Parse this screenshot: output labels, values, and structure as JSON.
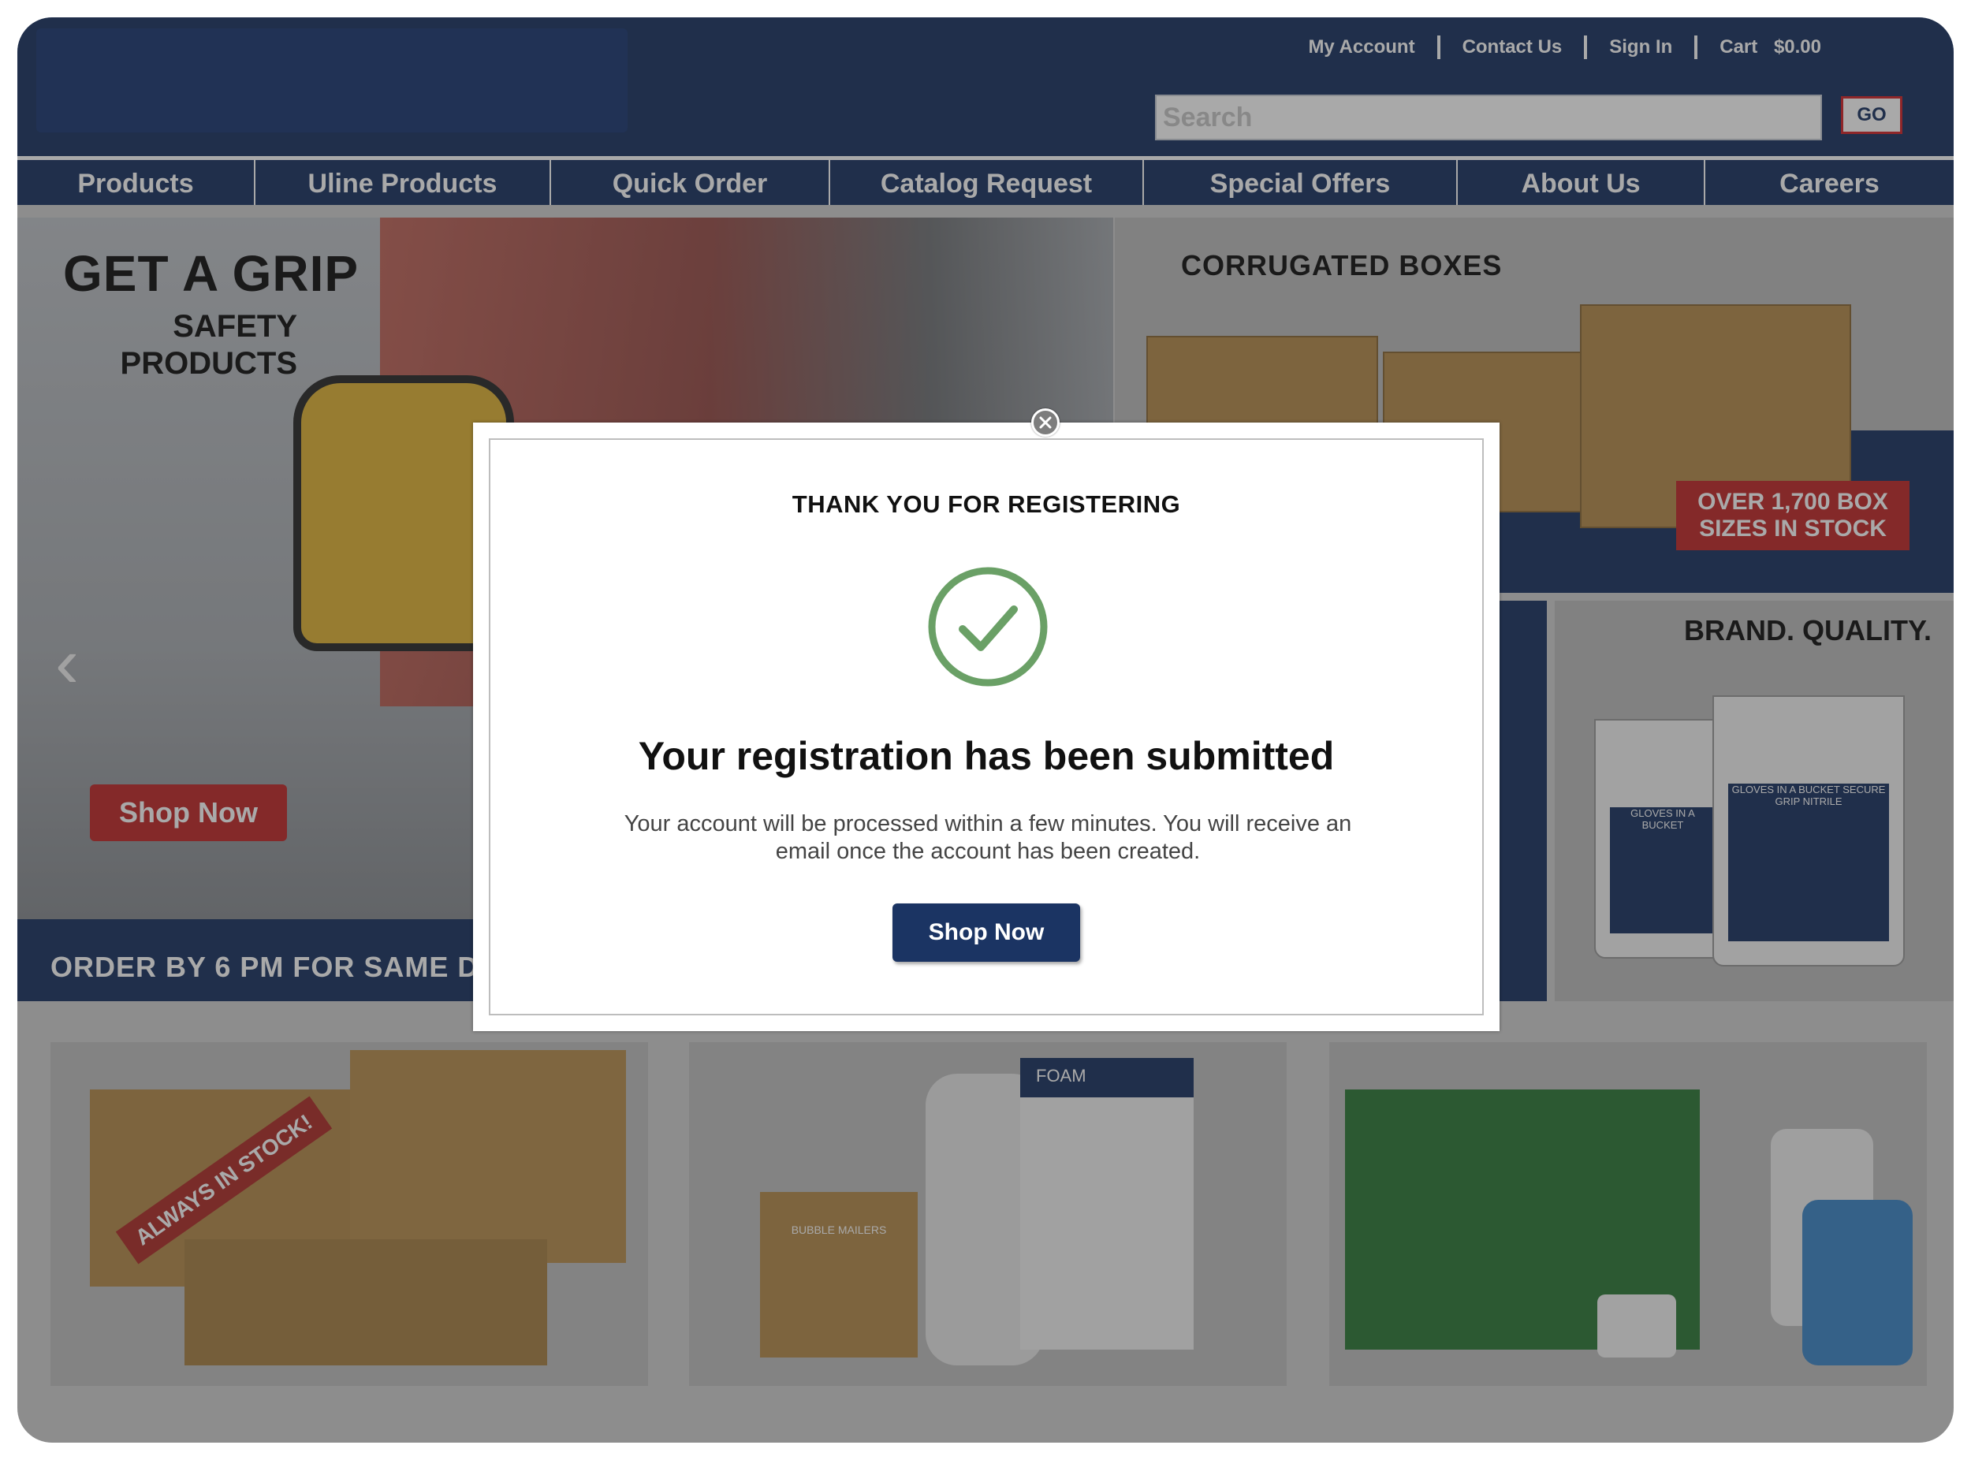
{
  "header": {
    "top_links": [
      "My Account",
      "Contact Us",
      "Sign In"
    ],
    "cart_label": "Cart",
    "cart_total": "$0.00",
    "search": {
      "placeholder": "Search",
      "value": ""
    },
    "go_label": "GO"
  },
  "nav": {
    "items": [
      "Products",
      "Uline Products",
      "Quick Order",
      "Catalog Request",
      "Special Offers",
      "About Us",
      "Careers"
    ]
  },
  "hero": {
    "title": "GET A GRIP",
    "subtitle": "SAFETY PRODUCTS",
    "shop_label": "Shop Now",
    "strip_text": "ORDER BY 6 PM FOR SAME DAY",
    "prev_icon": "chevron-left-icon"
  },
  "promos": {
    "boxes_title": "CORRUGATED BOXES",
    "boxes_badge": "OVER 1,700 BOX SIZES IN STOCK",
    "brand_title": "BRAND. QUALITY.",
    "bucket_label_1": "GLOVES IN A BUCKET",
    "bucket_label_2": "GLOVES IN A BUCKET SECURE GRIP NITRILE",
    "tile_1_banner": "ALWAYS IN STOCK!",
    "tile_2_box_label": "FOAM",
    "tile_2_mailer_label": "BUBBLE MAILERS"
  },
  "modal": {
    "heading": "THANK YOU FOR REGISTERING",
    "title": "Your registration has been submitted",
    "message": "Your account will be processed within a few minutes. You will receive an email once the account has been created.",
    "button_label": "Shop Now",
    "icon": "check-circle-icon",
    "close_icon": "close-icon",
    "accent_color": "#6aa066"
  },
  "colors": {
    "brand_navy": "#1b3463",
    "brand_red": "#c22a2a"
  }
}
